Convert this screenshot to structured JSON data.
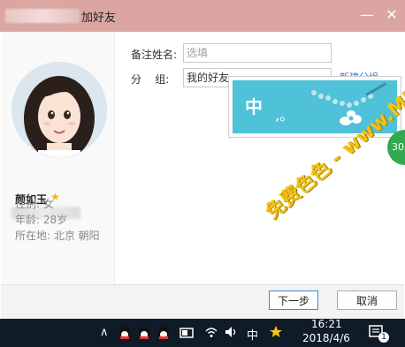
{
  "window": {
    "title": "加好友",
    "minimize_label": "—",
    "close_label": "✕"
  },
  "profile": {
    "nickname": "颜如玉",
    "gender": "性别: 女",
    "age": "年龄: 28岁",
    "location": "所在地: 北京  朝阳"
  },
  "form": {
    "remark_label": "备注姓名:",
    "remark_placeholder": "选填",
    "group_label": "分    组:",
    "group_value": "我的好友",
    "new_group_link": "新建分组"
  },
  "popup": {
    "banner_char": "中",
    "banner_mark": ",。"
  },
  "badge": {
    "text": "30"
  },
  "buttons": {
    "next": "下一步",
    "cancel": "取消"
  },
  "taskbar": {
    "time": "16:21",
    "date": "2018/4/6",
    "ime": "中",
    "chevron": "∧",
    "volume": "🔊",
    "network": "📶",
    "notifications_count": "1"
  },
  "watermark": {
    "text": "免费色色 - www.MFsese.com"
  },
  "colors": {
    "titlebar": "#dba6a2",
    "banner": "#4fc1d8",
    "badge": "#35a853",
    "taskbar": "#0f1c27",
    "watermark": "#f3c317"
  }
}
